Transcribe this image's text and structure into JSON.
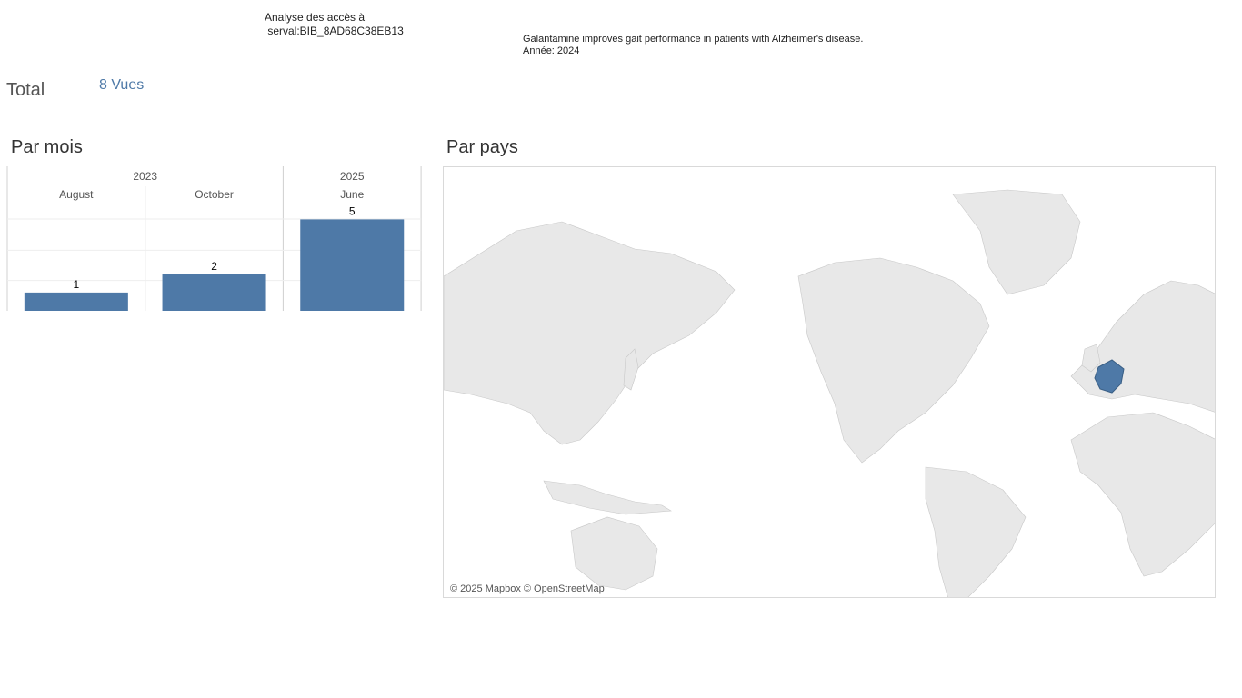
{
  "header": {
    "title_line1": "Analyse des accès à",
    "title_line2": " serval:BIB_8AD68C38EB13"
  },
  "publication": {
    "title": "Galantamine improves gait performance in patients with Alzheimer's disease.",
    "year_line": "Année: 2024"
  },
  "total": {
    "label": "Total",
    "value": "8 Vues"
  },
  "sections": {
    "by_month": "Par mois",
    "by_country": "Par pays"
  },
  "chart_data": {
    "type": "bar",
    "year_groups": [
      {
        "year": "2023",
        "months": [
          "August",
          "October"
        ]
      },
      {
        "year": "2025",
        "months": [
          "June"
        ]
      }
    ],
    "categories": [
      "August",
      "October",
      "June"
    ],
    "values": [
      1,
      2,
      5
    ],
    "ylim": [
      0,
      5
    ],
    "bar_color": "#4e79a7",
    "grid": true
  },
  "map": {
    "highlighted_country": "France",
    "highlight_color": "#4e79a7",
    "land_color": "#e8e8e8",
    "attribution": "© 2025 Mapbox © OpenStreetMap"
  }
}
